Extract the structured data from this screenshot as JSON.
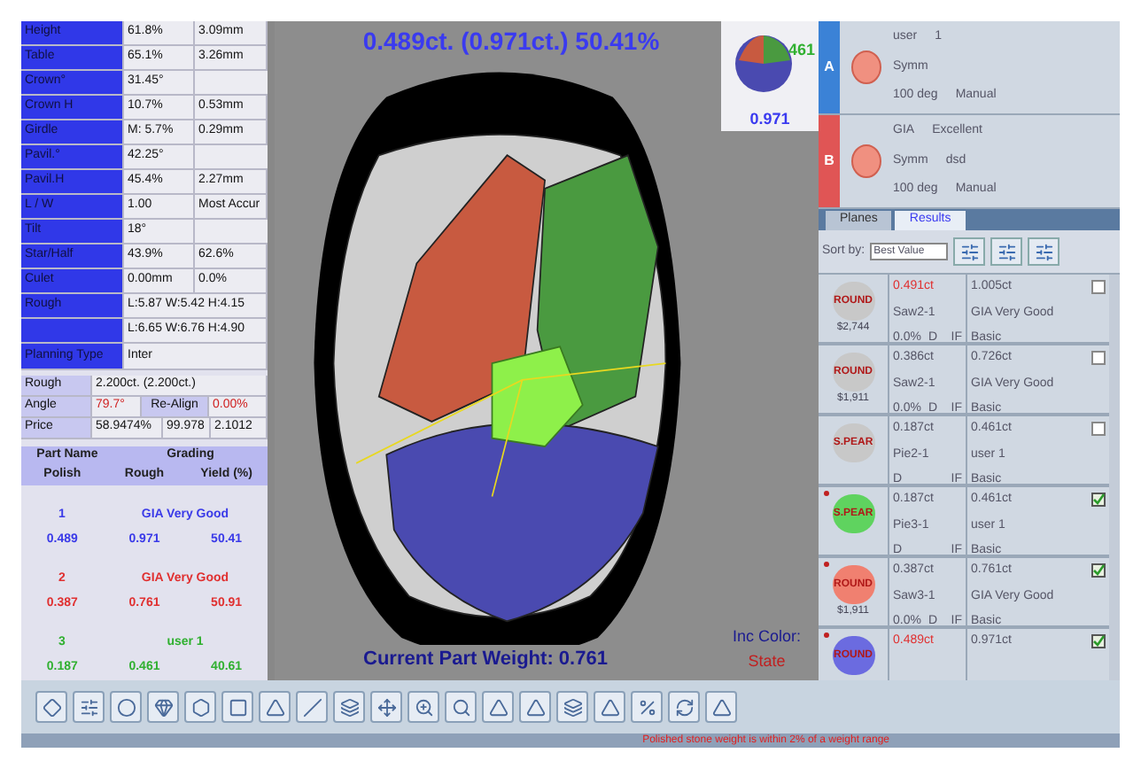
{
  "measurements": [
    {
      "label": "Height",
      "value": "61.8%",
      "extra": "3.09mm"
    },
    {
      "label": "Table",
      "value": "65.1%",
      "extra": "3.26mm"
    },
    {
      "label": "Crown°",
      "value": "31.45°"
    },
    {
      "label": "Crown H",
      "value": "10.7%",
      "extra": "0.53mm"
    },
    {
      "label": "Girdle",
      "value": "M: 5.7%",
      "extra": "0.29mm"
    },
    {
      "label": "Pavil.°",
      "value": "42.25°"
    },
    {
      "label": "Pavil.H",
      "value": "45.4%",
      "extra": "2.27mm"
    },
    {
      "label": "L / W",
      "value": "1.00",
      "extra": "Most Accur"
    },
    {
      "label": "Tilt",
      "value": "18°"
    },
    {
      "label": "Star/Half",
      "value": "43.9%",
      "extra": "62.6%"
    },
    {
      "label": "Culet",
      "value": "0.00mm",
      "extra": "0.0%"
    }
  ],
  "rough_lines": {
    "label": "Rough",
    "lines": [
      "L:5.87 W:5.42 H:4.15",
      "L:6.65 W:6.76 H:4.90"
    ]
  },
  "planning_type": {
    "label": "Planning Type",
    "value": "Inter"
  },
  "summary": {
    "rough": {
      "label": "Rough",
      "value": "2.200ct. (2.200ct.)"
    },
    "angle": {
      "label": "Angle",
      "value": "79.7°",
      "button": "Re-Align",
      "value2": "0.00%"
    },
    "price": {
      "label": "Price",
      "value": "58.9474%",
      "value2": "99.978",
      "value3": "2.1012"
    }
  },
  "parts_header": {
    "top": [
      "Part Name",
      "Grading"
    ],
    "bottom": [
      "Polish",
      "Rough",
      "Yield (%)"
    ]
  },
  "parts": [
    {
      "number": "1",
      "grading": "GIA Very Good",
      "polish": "0.489",
      "rough": "0.971",
      "yield": "50.41",
      "color": "#3a3ae8"
    },
    {
      "number": "2",
      "grading": "GIA Very Good",
      "polish": "0.387",
      "rough": "0.761",
      "yield": "50.91",
      "color": "#e03030"
    },
    {
      "number": "3",
      "grading": "user 1",
      "polish": "0.187",
      "rough": "0.461",
      "yield": "40.61",
      "color": "#30b030"
    }
  ],
  "viewer": {
    "top_label": "0.489ct. (0.971ct.) 50.41%",
    "thumb_labels": [
      "461",
      "0.971"
    ],
    "bottom_label": "Current Part Weight: 0.761",
    "inc_label": "Inc Color:",
    "inc_value": "State"
  },
  "stones": [
    {
      "tag": "A",
      "color": "#3b82d6",
      "line1": [
        "user",
        "1"
      ],
      "line2": [
        "Symm"
      ],
      "line3": [
        "100 deg",
        "Manual"
      ]
    },
    {
      "tag": "B",
      "color": "#e05555",
      "line1": [
        "GIA",
        "Excellent"
      ],
      "line2": [
        "Symm",
        "dsd"
      ],
      "line3": [
        "100 deg",
        "Manual"
      ]
    }
  ],
  "tabs": [
    {
      "label": "Planes",
      "selected": false
    },
    {
      "label": "Results",
      "selected": true
    }
  ],
  "sort": {
    "label": "Sort by:",
    "value": "Best Value"
  },
  "results": [
    {
      "badge": "ROUND",
      "color": "#c8c8c8",
      "price": "$2,744",
      "weight": "0.491ct",
      "alert": true,
      "plan": "Saw2-1",
      "pct": "0.0%",
      "cgrade": "D",
      "clarity": "IF",
      "rough": "1.005ct",
      "grade": "GIA Very Good",
      "type": "Basic",
      "checked": false,
      "marked": false
    },
    {
      "badge": "ROUND",
      "color": "#c8c8c8",
      "price": "$1,911",
      "weight": "0.386ct",
      "alert": false,
      "plan": "Saw2-1",
      "pct": "0.0%",
      "cgrade": "D",
      "clarity": "IF",
      "rough": "0.726ct",
      "grade": "GIA Very Good",
      "type": "Basic",
      "checked": false,
      "marked": false
    },
    {
      "badge": "S.PEAR",
      "color": "#c8c8c8",
      "weight": "0.187ct",
      "alert": false,
      "plan": "Pie2-1",
      "cgrade": "D",
      "clarity": "IF",
      "rough": "0.461ct",
      "grade": "user 1",
      "type": "Basic",
      "checked": false,
      "marked": false
    },
    {
      "badge": "S.PEAR",
      "color": "#5fd35f",
      "weight": "0.187ct",
      "alert": false,
      "plan": "Pie3-1",
      "cgrade": "D",
      "clarity": "IF",
      "rough": "0.461ct",
      "grade": "user 1",
      "type": "Basic",
      "checked": true,
      "marked": true
    },
    {
      "badge": "ROUND",
      "color": "#f08070",
      "price": "$1,911",
      "weight": "0.387ct",
      "alert": false,
      "plan": "Saw3-1",
      "pct": "0.0%",
      "cgrade": "D",
      "clarity": "IF",
      "rough": "0.761ct",
      "grade": "GIA Very Good",
      "type": "Basic",
      "checked": true,
      "marked": true
    },
    {
      "badge": "ROUND",
      "color": "#6b6be0",
      "weight": "0.489ct",
      "alert": true,
      "rough": "0.971ct",
      "checked": true,
      "marked": true
    }
  ],
  "status": "Polished stone weight is within 2%  of a weight range"
}
